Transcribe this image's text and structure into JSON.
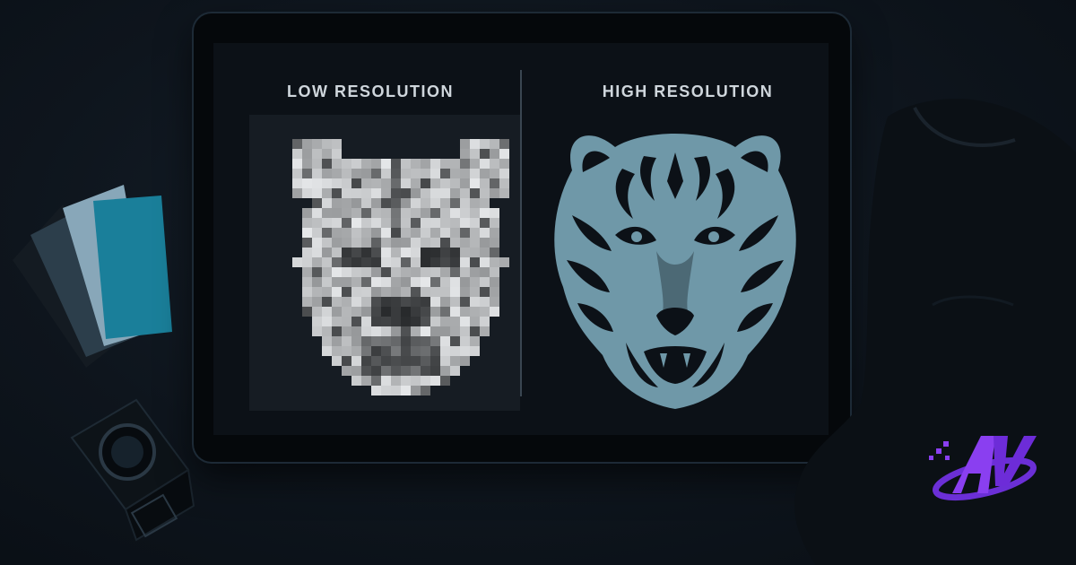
{
  "panels": {
    "low_title": "LOW RESOLUTION",
    "high_title": "HIGH RESOLUTION"
  },
  "colors": {
    "background": "#0e151d",
    "tiger_high": "#6f98a8",
    "tiger_low": "#c9ccce",
    "logo_purple": "#8a3ff0",
    "swatch_teal": "#1a7f9a"
  },
  "icons": {
    "loupe": "loupe-icon",
    "logo": "av-logo-icon"
  }
}
